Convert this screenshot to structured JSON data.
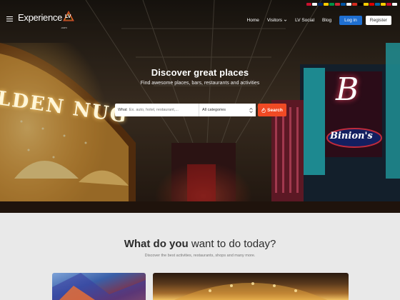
{
  "flags": [
    "#c8102e",
    "#ffffff",
    "#002868",
    "#ffcc00",
    "#009246",
    "#ce2b37",
    "#0055a4",
    "#ffffff",
    "#d52b1e",
    "#000000",
    "#ffce00",
    "#dd0000",
    "#006aa7",
    "#fecc00",
    "#c60c30",
    "#ffffff"
  ],
  "nav": {
    "logo_text": "Experience",
    "logo_mark": "LV",
    "logo_sub": ".com",
    "links": [
      {
        "label": "Home"
      },
      {
        "label": "Visitors",
        "dropdown": true
      },
      {
        "label": "LV Social"
      },
      {
        "label": "Blog"
      }
    ],
    "login_label": "Log in",
    "register_label": "Register"
  },
  "hero": {
    "title": "Discover great places",
    "subtitle": "Find awesome places, bars, restaurants and activities",
    "search": {
      "what_label": "What",
      "what_placeholder": "Ex. auto, hotel, restaurant,...",
      "category_value": "All categories",
      "button_label": "Search",
      "button_icon": "fire-icon"
    },
    "signs": {
      "golden_nugget": "LDEN NUG",
      "binions": "Binion's",
      "b_letter": "B"
    }
  },
  "section": {
    "title_bold": "What do you",
    "title_rest": " want to do today?",
    "subtitle": "Discover the best activities, restaurants, shops and many more."
  },
  "colors": {
    "accent": "#f04a24",
    "login": "#1f6fd1"
  }
}
